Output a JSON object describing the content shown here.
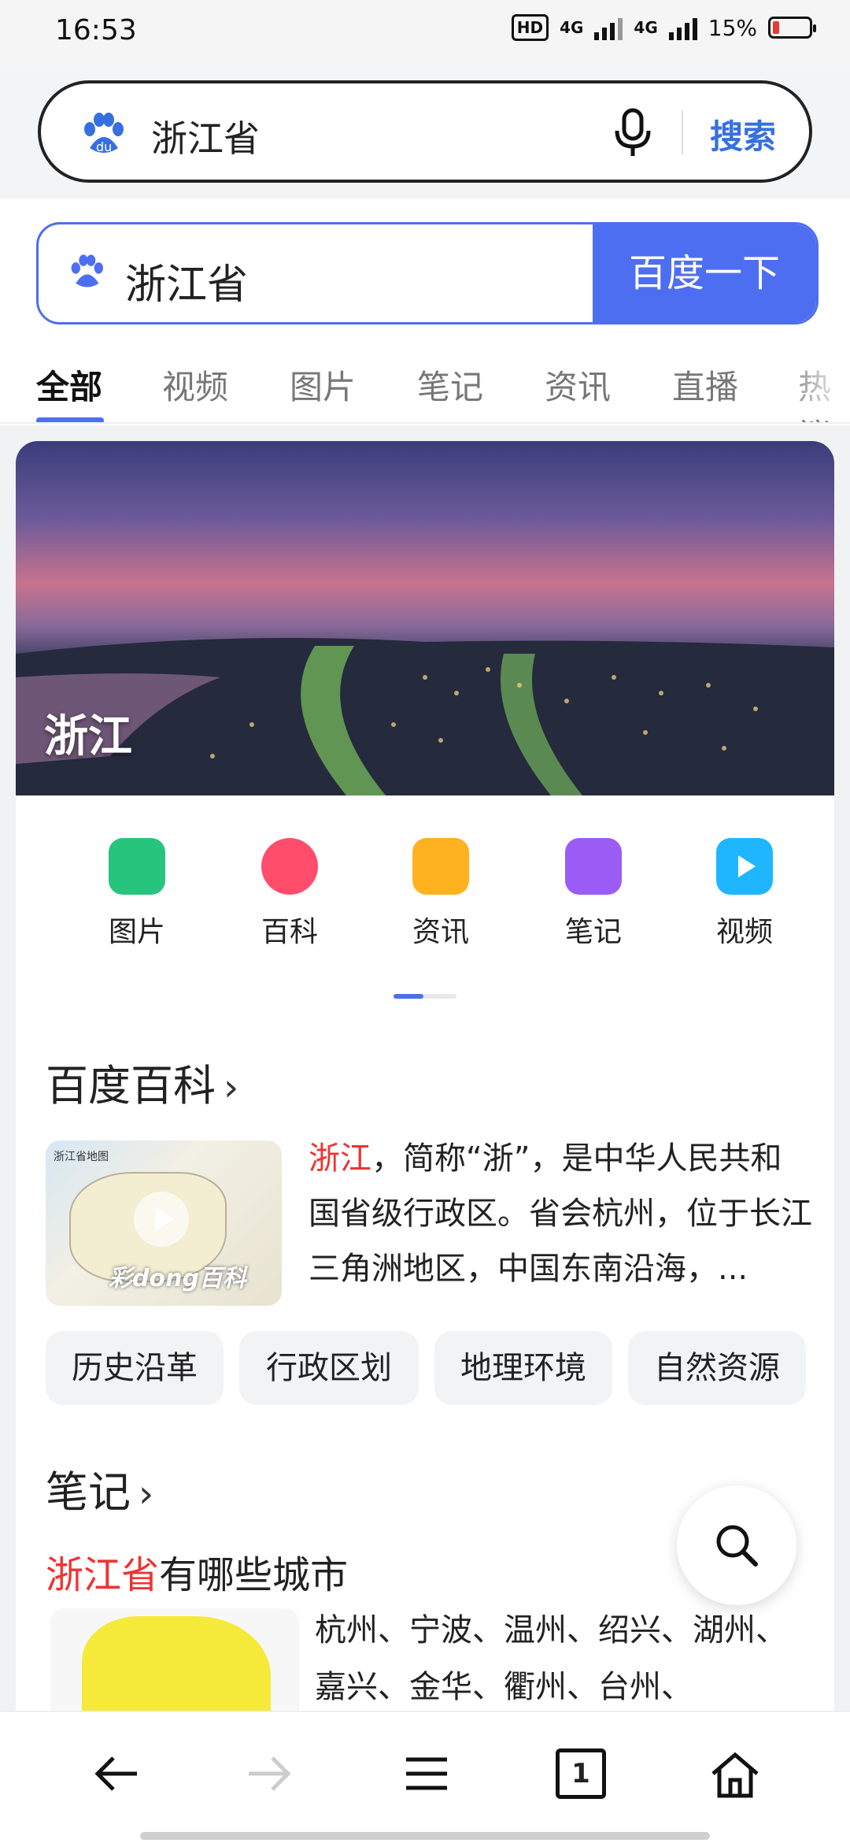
{
  "status_bar": {
    "time": "16:53",
    "hd_label": "HD",
    "network1": "4G",
    "network2": "4G",
    "battery_percent": "15%"
  },
  "top_search": {
    "query": "浙江省",
    "search_button": "搜索"
  },
  "search_box": {
    "query": "浙江省",
    "button": "百度一下"
  },
  "tabs": [
    {
      "label": "全部",
      "active": true
    },
    {
      "label": "视频"
    },
    {
      "label": "图片"
    },
    {
      "label": "笔记"
    },
    {
      "label": "资讯"
    },
    {
      "label": "直播"
    },
    {
      "label": "热议"
    }
  ],
  "hero": {
    "title": "浙江"
  },
  "quick_links": [
    {
      "label": "图片",
      "icon": "image-icon",
      "color": "#27c47e"
    },
    {
      "label": "百科",
      "icon": "baike-icon",
      "color": "#ff4d6b"
    },
    {
      "label": "资讯",
      "icon": "news-icon",
      "color": "#ffb21f"
    },
    {
      "label": "笔记",
      "icon": "note-icon",
      "color": "#9b5cf6"
    },
    {
      "label": "视频",
      "icon": "video-icon",
      "color": "#1fb6ff"
    }
  ],
  "baike": {
    "section_title": "百度百科",
    "image_caption": "浙江省地图",
    "image_logo": "彩dong百科",
    "highlight": "浙江",
    "summary": "，简称“浙”，是中华人民共和国省级行政区。省会杭州，位于长江三角洲地区，中国东南沿海，...",
    "chips": [
      "历史沿革",
      "行政区划",
      "地理环境",
      "自然资源"
    ]
  },
  "notes": {
    "section_title": "笔记",
    "question_highlight": "浙江省",
    "question_rest": "有哪些城市",
    "answer": "杭州、宁波、温州、绍兴、湖州、嘉兴、金华、衢州、台州、"
  },
  "nav": {
    "tab_count": "1"
  },
  "colors": {
    "accent": "#4e6ef2",
    "highlight_red": "#e33333"
  }
}
